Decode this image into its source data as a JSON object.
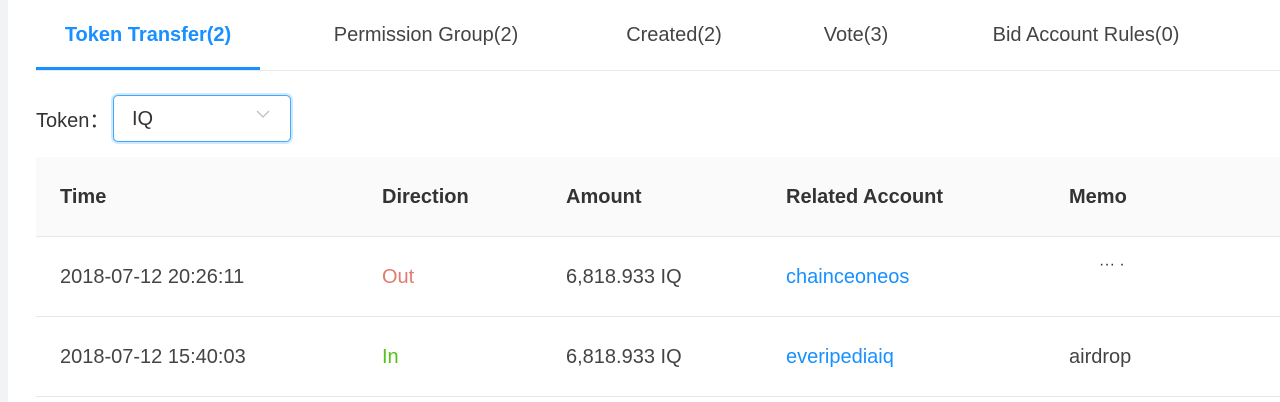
{
  "tabs": [
    {
      "label": "Token Transfer(2)",
      "active": true
    },
    {
      "label": "Permission Group(2)",
      "active": false
    },
    {
      "label": "Created(2)",
      "active": false
    },
    {
      "label": "Vote(3)",
      "active": false
    },
    {
      "label": "Bid Account Rules(0)",
      "active": false
    }
  ],
  "filter": {
    "label": "Token：",
    "selected": "IQ"
  },
  "table": {
    "headers": [
      "Time",
      "Direction",
      "Amount",
      "Related Account",
      "Memo"
    ],
    "rows": [
      {
        "time": "2018-07-12 20:26:11",
        "direction": "Out",
        "amount": "6,818.933 IQ",
        "account": "chainceoneos",
        "memo": "···  ·"
      },
      {
        "time": "2018-07-12 15:40:03",
        "direction": "In",
        "amount": "6,818.933 IQ",
        "account": "everipediaiq",
        "memo": "airdrop"
      }
    ]
  },
  "colors": {
    "accent": "#1890ff",
    "out": "#e27c6e",
    "in": "#52c41a"
  }
}
